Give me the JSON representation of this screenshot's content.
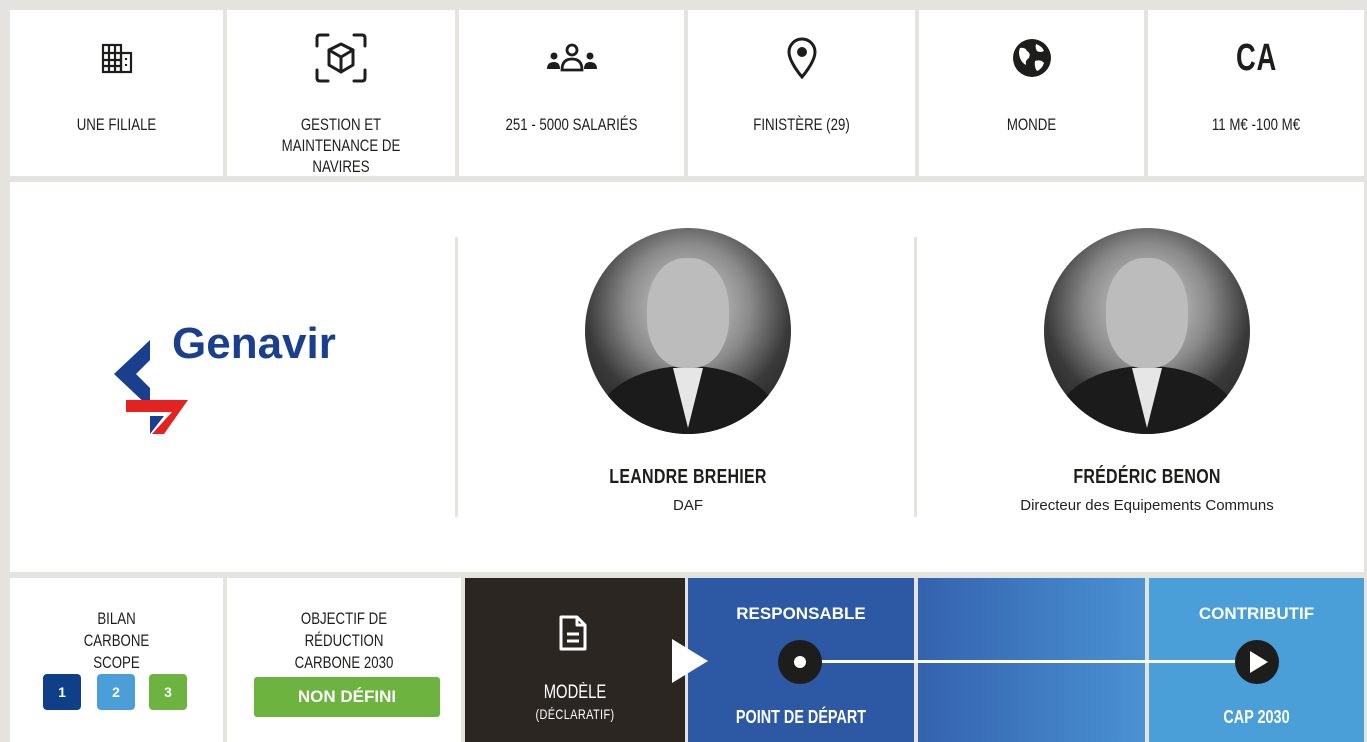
{
  "stats": [
    {
      "icon": "building-icon",
      "label": "UNE FILIALE"
    },
    {
      "icon": "box-scan-icon",
      "label": "GESTION ET MAINTENANCE DE NAVIRES"
    },
    {
      "icon": "people-icon",
      "label": "251 - 5000 SALARIÉS"
    },
    {
      "icon": "location-pin-icon",
      "label": "FINISTÈRE (29)"
    },
    {
      "icon": "globe-icon",
      "label": "MONDE"
    },
    {
      "icon": "ca-text-icon",
      "icon_text": "CA",
      "label": "11 M€ -100 M€"
    }
  ],
  "company": {
    "logo_text": "Genavir"
  },
  "people": [
    {
      "name": "LEANDRE BREHIER",
      "role": "DAF"
    },
    {
      "name": "FRÉDÉRIC BENON",
      "role": "Directeur des Equipements Communs"
    }
  ],
  "bilan": {
    "title": "BILAN CARBONE SCOPE",
    "scopes": [
      "1",
      "2",
      "3"
    ],
    "scope_colors": [
      "#0f3f86",
      "#4c9ed8",
      "#6cb33f"
    ]
  },
  "objectif": {
    "title": "OBJECTIF DE RÉDUCTION CARBONE 2030",
    "badge": "NON DÉFINI"
  },
  "modele": {
    "title": "MODÈLE",
    "subtitle": "(DÉCLARATIF)"
  },
  "trajectory": {
    "start_top": "RESPONSABLE",
    "start_bottom": "POINT DE DÉPART",
    "end_top": "CONTRIBUTIF",
    "end_bottom": "CAP 2030"
  },
  "colors": {
    "dark_blue": "#2c58a4",
    "mid_blue": "#3f7ec6",
    "light_blue": "#4a9fd8",
    "dark": "#2b2622",
    "green": "#6cb33f"
  }
}
